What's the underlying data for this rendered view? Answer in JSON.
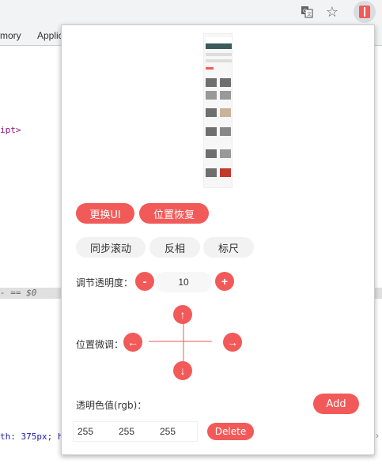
{
  "browser": {
    "translate_icon": "translate-icon",
    "star_icon": "star-icon",
    "extension_icon": "extension-icon"
  },
  "devtools": {
    "tabs": [
      "mory",
      "Applic"
    ],
    "lines": {
      "script_tag": "ipt>",
      "selected": "- == $0",
      "style_line": "th: 375px; h"
    }
  },
  "popup": {
    "buttons": {
      "change_ui": "更换UI",
      "reset_position": "位置恢复",
      "sync_scroll": "同步滚动",
      "invert": "反相",
      "ruler": "标尺"
    },
    "opacity": {
      "label": "调节透明度：",
      "minus": "-",
      "value": "10",
      "plus": "+"
    },
    "position": {
      "label": "位置微调：",
      "up": "↑",
      "down": "↓",
      "left": "←",
      "right": "→"
    },
    "transparent_color": {
      "label": "透明色值(rgb)：",
      "add": "Add",
      "r": "255",
      "g": "255",
      "b": "255",
      "delete": "Delete"
    }
  },
  "colors": {
    "accent": "#f25a59",
    "pill_gray": "#f2f2f2"
  }
}
